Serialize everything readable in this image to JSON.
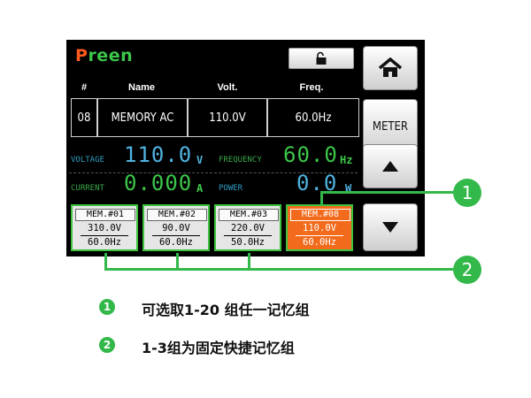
{
  "brand": "Preen",
  "header": {
    "col_num": "#",
    "col_name": "Name",
    "col_volt": "Volt.",
    "col_freq": "Freq."
  },
  "current_row": {
    "num": "08",
    "name": "MEMORY AC",
    "volt": "110.0V",
    "freq": "60.0Hz"
  },
  "meters": {
    "voltage": {
      "label": "VOLTAGE",
      "value": "110.0",
      "unit": "V"
    },
    "frequency": {
      "label": "FREQUENCY",
      "value": "60.0",
      "unit": "Hz"
    },
    "current": {
      "label": "CURRENT",
      "value": "0.000",
      "unit": "A"
    },
    "power": {
      "label": "POWER",
      "value": "0.0",
      "unit": "W"
    }
  },
  "memories": [
    {
      "title": "MEM.#01",
      "volt": "310.0V",
      "freq": "60.0Hz",
      "active": false
    },
    {
      "title": "MEM.#02",
      "volt": "90.0V",
      "freq": "60.0Hz",
      "active": false
    },
    {
      "title": "MEM.#03",
      "volt": "220.0V",
      "freq": "50.0Hz",
      "active": false
    },
    {
      "title": "MEM.#08",
      "volt": "110.0V",
      "freq": "60.0Hz",
      "active": true
    }
  ],
  "sidebar": {
    "meter_label": "METER"
  },
  "callouts": {
    "one": "1",
    "two": "2"
  },
  "legend": [
    {
      "num": "1",
      "text": "可选取1-20 组任一记忆组"
    },
    {
      "num": "2",
      "text": "1-3组为固定快捷记忆组"
    }
  ],
  "colors": {
    "accent_green": "#33b84a",
    "active_orange": "#f26a1b",
    "voltage_blue": "#4fb3e0",
    "meter_green": "#3cc64a"
  }
}
